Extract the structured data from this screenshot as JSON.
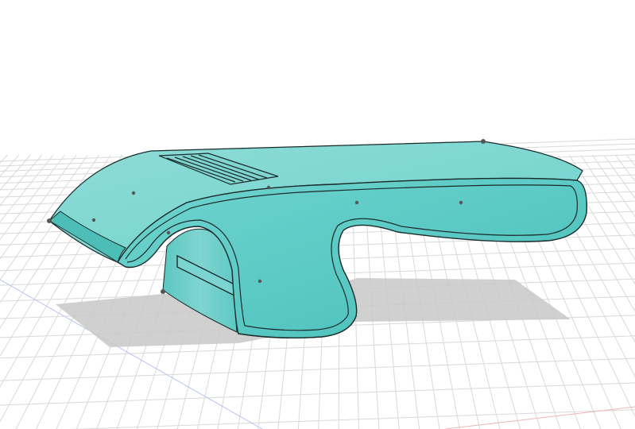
{
  "viewport": {
    "background": "#ffffff",
    "grid_color": "#d9d9d9",
    "axis_x_color": "#e9a7a7",
    "axis_y_color": "#a7b4e9"
  },
  "model": {
    "name": "",
    "body_color": "#5ccbc6",
    "top_color": "#86d9d3",
    "edge_color": "#1a2a2a",
    "shadow_color": "#c9c9c9",
    "vertex_color": "#6a6a6a"
  }
}
